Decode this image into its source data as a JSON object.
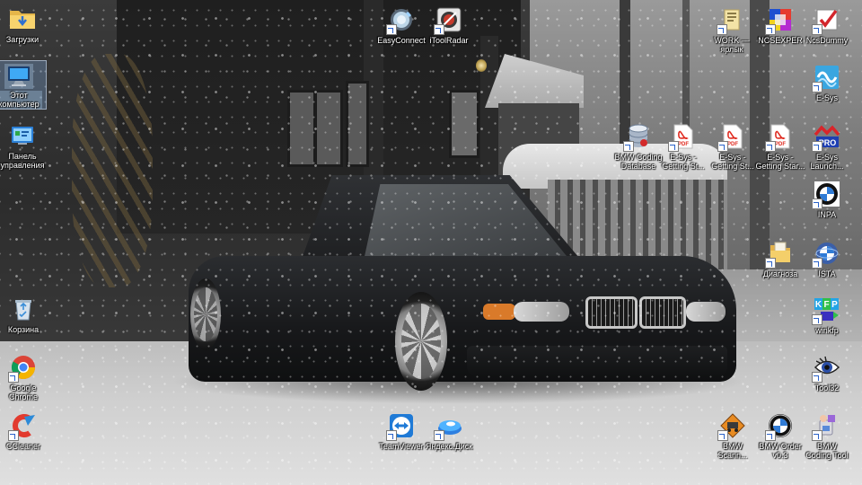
{
  "desktop": {
    "icons": [
      {
        "id": "zagruzki",
        "label": "Загрузки",
        "icon": "folder-downloads-icon",
        "shortcut": false
      },
      {
        "id": "etot-kompyuter",
        "label": "Этот компьютер",
        "icon": "computer-icon",
        "shortcut": false,
        "selected": true
      },
      {
        "id": "panel-upravleniya",
        "label": "Панель управления",
        "icon": "control-panel-icon",
        "shortcut": false
      },
      {
        "id": "korzina",
        "label": "Корзина",
        "icon": "recycle-bin-icon",
        "shortcut": false
      },
      {
        "id": "google-chrome",
        "label": "Google Chrome",
        "icon": "chrome-icon",
        "shortcut": true
      },
      {
        "id": "ccleaner",
        "label": "CCleaner",
        "icon": "ccleaner-icon",
        "shortcut": true
      },
      {
        "id": "easyconnect",
        "label": "EasyConnect",
        "icon": "easyconnect-icon",
        "shortcut": true
      },
      {
        "id": "itoolradar",
        "label": "iToolRadar",
        "icon": "itoolradar-icon",
        "shortcut": true
      },
      {
        "id": "teamviewer",
        "label": "TeamViewer",
        "icon": "teamviewer-icon",
        "shortcut": true
      },
      {
        "id": "yandex-disk",
        "label": "Яндекс.Диск",
        "icon": "yandex-disk-icon",
        "shortcut": true
      },
      {
        "id": "work",
        "label": "WORK — ярлык",
        "icon": "folder-icon",
        "shortcut": true
      },
      {
        "id": "ncsexper",
        "label": "NCSEXPER",
        "icon": "ncsexper-icon",
        "shortcut": true
      },
      {
        "id": "ncsdummy",
        "label": "NcsDummy",
        "icon": "ncsdummy-icon",
        "shortcut": true
      },
      {
        "id": "e-sys",
        "label": "E-Sys",
        "icon": "e-sys-icon",
        "shortcut": true
      },
      {
        "id": "bmw-coding-database",
        "label": "BMW Coding Database",
        "icon": "database-icon",
        "shortcut": true
      },
      {
        "id": "e-sys-getting-started-1",
        "label": "E-Sys - Getting St...",
        "icon": "pdf-icon",
        "shortcut": true
      },
      {
        "id": "e-sys-getting-started-2",
        "label": "E-Sys - Getting St...",
        "icon": "pdf-icon",
        "shortcut": true
      },
      {
        "id": "e-sys-getting-started-3",
        "label": "E-Sys - Getting Star...",
        "icon": "pdf-icon",
        "shortcut": true
      },
      {
        "id": "e-sys-launcher",
        "label": "E-Sys Launch...",
        "icon": "e-sys-launcher-icon",
        "shortcut": true
      },
      {
        "id": "inpa",
        "label": "INPA",
        "icon": "bmw-logo-icon",
        "shortcut": true
      },
      {
        "id": "diagnoza",
        "label": "Диагноза",
        "icon": "folder-icon",
        "shortcut": true
      },
      {
        "id": "ista",
        "label": "ISTA",
        "icon": "bmw-globe-icon",
        "shortcut": true
      },
      {
        "id": "winkfp",
        "label": "winkfp",
        "icon": "winkfp-icon",
        "shortcut": true
      },
      {
        "id": "tool32",
        "label": "Tool32",
        "icon": "eye-icon",
        "shortcut": true
      },
      {
        "id": "bmw-scanner",
        "label": "BMW Scann...",
        "icon": "bmw-scanner-icon",
        "shortcut": true
      },
      {
        "id": "bmw-order",
        "label": "BMW Order v0.3",
        "icon": "bmw-logo-icon",
        "shortcut": true
      },
      {
        "id": "bmw-coding-tool",
        "label": "BMW Coding Tool",
        "icon": "bmw-coding-tool-icon",
        "shortcut": true
      }
    ]
  }
}
